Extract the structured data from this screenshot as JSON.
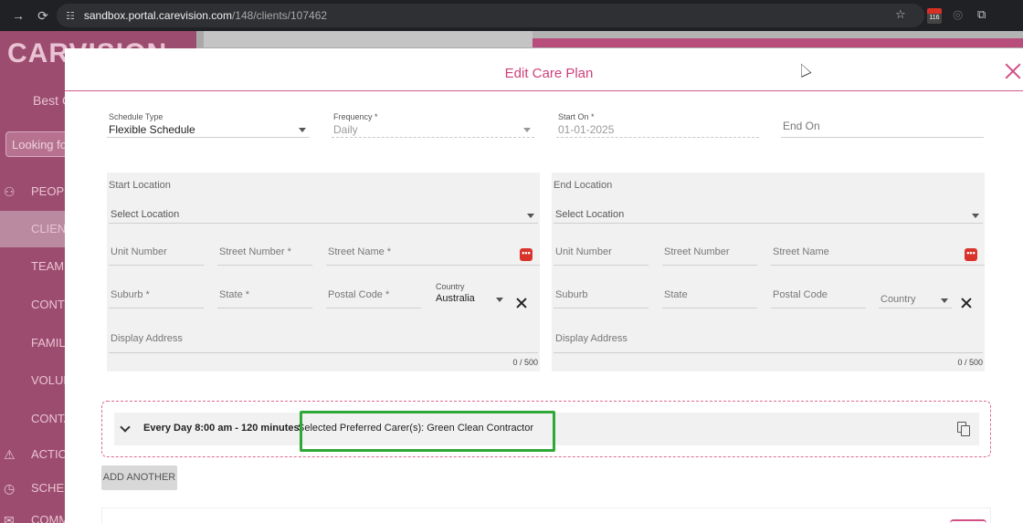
{
  "browser": {
    "url_domain": "sandbox.portal.carevision.com",
    "url_path": "/148/clients/107462",
    "calendar_badge": "116"
  },
  "sidebar": {
    "brand": "CARVISION",
    "tagline": "Best C",
    "search_placeholder": "Looking fo",
    "items": [
      {
        "label": "PEOPL",
        "icon": "people-icon"
      },
      {
        "label": "CLIENT",
        "icon": ""
      },
      {
        "label": "TEAMS",
        "icon": ""
      },
      {
        "label": "CONTR",
        "icon": ""
      },
      {
        "label": "FAMILY",
        "icon": ""
      },
      {
        "label": "VOLUN",
        "icon": ""
      },
      {
        "label": "CONTA",
        "icon": ""
      },
      {
        "label": "ACTION",
        "icon": "warning-icon"
      },
      {
        "label": "SCHED",
        "icon": "clock-icon"
      },
      {
        "label": "COMM",
        "icon": "chat-icon"
      }
    ]
  },
  "modal": {
    "title": "Edit Care Plan",
    "schedule_type": {
      "label": "Schedule Type",
      "value": "Flexible Schedule"
    },
    "frequency": {
      "label": "Frequency *",
      "value": "Daily"
    },
    "start_on": {
      "label": "Start On *",
      "value": "01-01-2025"
    },
    "end_on": {
      "placeholder": "End On"
    },
    "start_location": {
      "title": "Start Location",
      "select_placeholder": "Select Location",
      "unit_number": "Unit Number",
      "street_number": "Street Number *",
      "street_name": "Street Name *",
      "suburb": "Suburb *",
      "state": "State *",
      "postal_code": "Postal Code *",
      "country_label": "Country",
      "country_value": "Australia",
      "display_address": "Display Address",
      "counter": "0 / 500"
    },
    "end_location": {
      "title": "End Location",
      "select_placeholder": "Select Location",
      "unit_number": "Unit Number",
      "street_number": "Street Number",
      "street_name": "Street Name",
      "suburb": "Suburb",
      "state": "State",
      "postal_code": "Postal Code",
      "country_placeholder": "Country",
      "display_address": "Display Address",
      "counter": "0 / 500"
    },
    "schedule_entry": {
      "summary": "Every Day 8:00 am - 120 minutes",
      "preferred": "Selected Preferred Carer(s): Green Clean Contractor"
    },
    "add_another": "ADD ANOTHER",
    "more_icon_glyph": "•••"
  },
  "colors": {
    "accent": "#cf3f78",
    "highlight": "#2ea836",
    "sidebar": "#9c4c6e"
  }
}
